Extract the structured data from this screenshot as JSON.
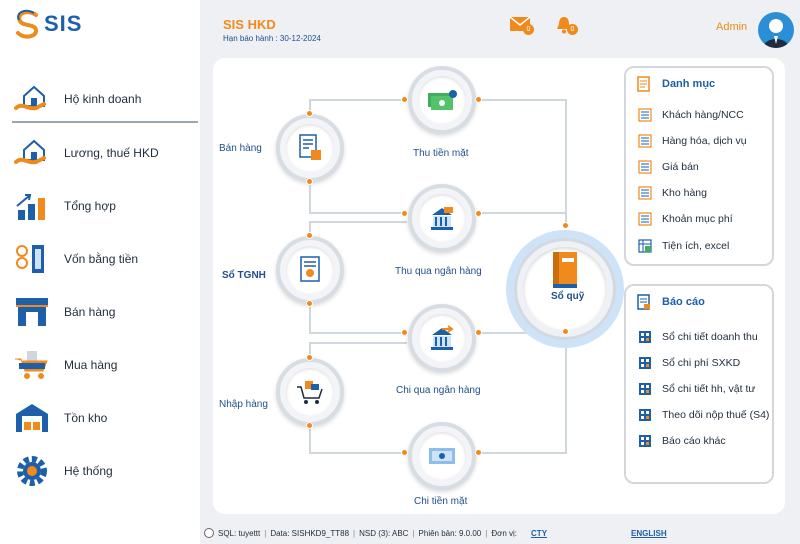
{
  "app": {
    "logo_text": "SIS",
    "title": "SIS HKD",
    "subtitle": "Hạn báo hành : 30-12-2024",
    "mail_count": "0",
    "bell_count": "0",
    "user": "Admin"
  },
  "sidebar": {
    "items": [
      {
        "label": "Hộ kinh doanh",
        "icon": "house-hand-icon"
      },
      {
        "label": "Lương, thuế HKD",
        "icon": "house-hand-icon"
      },
      {
        "label": "Tổng hợp",
        "icon": "bar-chart-icon"
      },
      {
        "label": "Vốn bằng tiền",
        "icon": "coins-door-icon"
      },
      {
        "label": "Bán hàng",
        "icon": "store-icon"
      },
      {
        "label": "Mua hàng",
        "icon": "cart-icon"
      },
      {
        "label": "Tồn kho",
        "icon": "warehouse-icon"
      },
      {
        "label": "Hệ thống",
        "icon": "gear-icon"
      }
    ]
  },
  "flow": {
    "ban_hang": "Bán hàng",
    "so_tgnh": "Sổ TGNH",
    "nhap_hang": "Nhập hàng",
    "thu_tien_mat": "Thu tiền mặt",
    "thu_qua_ngan_hang": "Thu qua ngân hàng",
    "chi_qua_ngan_hang": "Chi qua ngân hàng",
    "chi_tien_mat": "Chi tiền mặt",
    "so_quy": "Sổ quỹ"
  },
  "danh_muc": {
    "title": "Danh mục",
    "items": [
      "Khách hàng/NCC",
      "Hàng hóa, dịch vụ",
      "Giá bán",
      "Kho hàng",
      "Khoản mục phí",
      "Tiện ích, excel"
    ]
  },
  "bao_cao": {
    "title": "Báo cáo",
    "items": [
      "Sổ chi tiết doanh thu",
      "Sổ chi phí SXKD",
      "Sổ chi tiết hh, vật tư",
      "Theo dõi nộp thuế (S4)",
      "Báo cáo khác"
    ]
  },
  "status": {
    "sql": "SQL: tuyettt",
    "data": "Data: SISHKD9_TT88",
    "nsd": "NSD (3): ABC",
    "version": "Phiên bản: 9.0.00",
    "don_vi": "Đơn vị:",
    "unit_link": "CTY",
    "lang_link": "ENGLISH"
  },
  "colors": {
    "accent": "#f08a1c",
    "brand": "#1d5fa8",
    "panel_bg": "#eef0f3"
  }
}
